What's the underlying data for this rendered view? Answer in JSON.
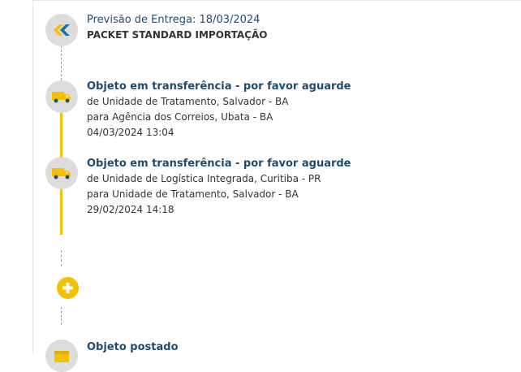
{
  "header": {
    "forecast_label": "Previsão de Entrega: 18/03/2024",
    "service": "PACKET STANDARD IMPORTAÇÃO",
    "icon": "correios-logo-icon"
  },
  "events": [
    {
      "title": "Objeto em transferência - por favor aguarde",
      "from": "de Unidade de Tratamento, Salvador - BA",
      "to": "para Agência dos Correios, Ubata - BA",
      "datetime": "04/03/2024 13:04",
      "icon": "truck-icon"
    },
    {
      "title": "Objeto em transferência - por favor aguarde",
      "from": "de Unidade de Logística Integrada, Curitiba - PR",
      "to": "para Unidade de Tratamento, Salvador - BA",
      "datetime": "29/02/2024 14:18",
      "icon": "truck-icon"
    }
  ],
  "expand": {
    "icon": "plus-icon"
  },
  "last_event": {
    "title": "Objeto postado",
    "icon": "box-icon"
  },
  "colors": {
    "accent": "#f2c200",
    "title": "#1e4c6e",
    "node_bg": "#dcdcdc"
  }
}
